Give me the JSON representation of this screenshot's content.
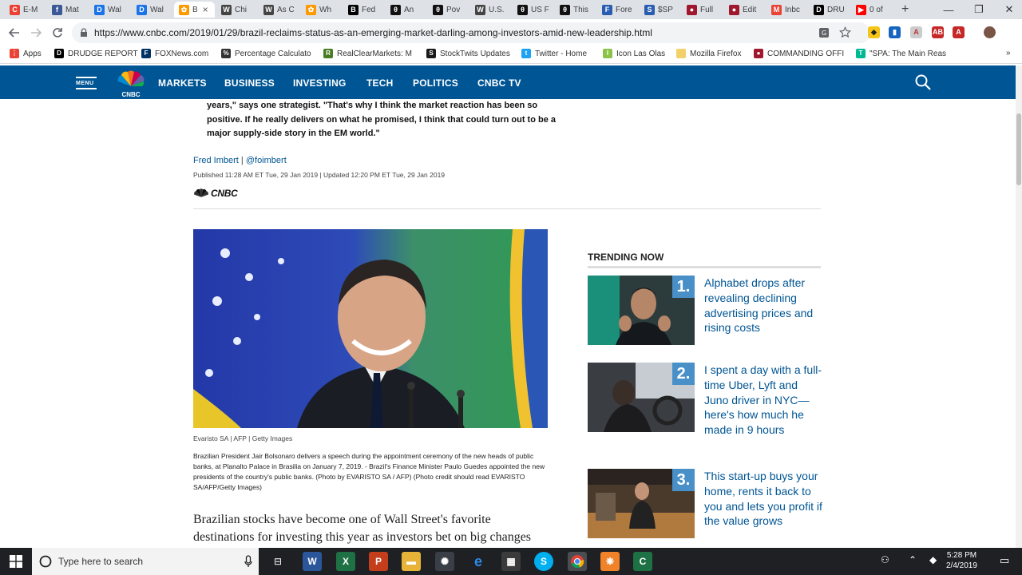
{
  "tabs": [
    {
      "label": "E-M",
      "icon": "gmail-icon",
      "color": "#ea4335",
      "glyph": "C"
    },
    {
      "label": "Mat",
      "icon": "facebook-icon",
      "color": "#3b5998",
      "glyph": "f"
    },
    {
      "label": "Wal",
      "icon": "wallet-icon",
      "color": "#1a73e8",
      "glyph": "D"
    },
    {
      "label": "Wal",
      "icon": "wallet-icon",
      "color": "#1a73e8",
      "glyph": "D"
    },
    {
      "label": "B",
      "icon": "cnbc-icon",
      "color": "#ff9900",
      "glyph": "✿",
      "active": true
    },
    {
      "label": "Chi",
      "icon": "wsj-icon",
      "color": "#444",
      "glyph": "W"
    },
    {
      "label": "As C",
      "icon": "wsj-icon",
      "color": "#444",
      "glyph": "W"
    },
    {
      "label": "Wh",
      "icon": "cnbc-icon",
      "color": "#ff9900",
      "glyph": "✿"
    },
    {
      "label": "Fed",
      "icon": "bloomberg-icon",
      "color": "#000",
      "glyph": "B"
    },
    {
      "label": "An",
      "icon": "barrons-icon",
      "color": "#111",
      "glyph": "θ"
    },
    {
      "label": "Pov",
      "icon": "barrons-icon",
      "color": "#111",
      "glyph": "θ"
    },
    {
      "label": "U.S.",
      "icon": "wsj-icon",
      "color": "#444",
      "glyph": "W"
    },
    {
      "label": "US F",
      "icon": "barrons-icon",
      "color": "#111",
      "glyph": "θ"
    },
    {
      "label": "This",
      "icon": "barrons-icon",
      "color": "#111",
      "glyph": "θ"
    },
    {
      "label": "Fore",
      "icon": "forex-icon",
      "color": "#2a5db0",
      "glyph": "F"
    },
    {
      "label": "$SP",
      "icon": "stockcharts-icon",
      "color": "#2a5db0",
      "glyph": "S"
    },
    {
      "label": "Full",
      "icon": "commanding-icon",
      "color": "#a0182e",
      "glyph": "●"
    },
    {
      "label": "Edit",
      "icon": "commanding-icon",
      "color": "#a0182e",
      "glyph": "●"
    },
    {
      "label": "Inbc",
      "icon": "gmail-icon",
      "color": "#ea4335",
      "glyph": "M"
    },
    {
      "label": "DRU",
      "icon": "drudge-icon",
      "color": "#000",
      "glyph": "D"
    },
    {
      "label": "0 of",
      "icon": "youtube-icon",
      "color": "#ff0000",
      "glyph": "▶"
    }
  ],
  "active_tab_close": "×",
  "new_tab": "+",
  "window_controls": {
    "minimize": "—",
    "restore": "❐",
    "close": "✕"
  },
  "address_bar": {
    "url": "https://www.cnbc.com/2019/01/29/brazil-reclaims-status-as-an-emerging-market-darling-among-investors-amid-new-leadership.html"
  },
  "bookmarks": [
    {
      "label": "Apps",
      "icon": "apps-grid-icon",
      "color": "#ea4335",
      "glyph": "⋮"
    },
    {
      "label": "DRUDGE REPORT",
      "icon": "drudge-icon",
      "color": "#000",
      "glyph": "D"
    },
    {
      "label": "FOXNews.com",
      "icon": "fox-icon",
      "color": "#003366",
      "glyph": "F"
    },
    {
      "label": "Percentage Calculato",
      "icon": "percent-icon",
      "color": "#333",
      "glyph": "%"
    },
    {
      "label": "RealClearMarkets: M",
      "icon": "rcm-icon",
      "color": "#4a7c23",
      "glyph": "R"
    },
    {
      "label": "StockTwits Updates",
      "icon": "stocktwits-icon",
      "color": "#1a1a1a",
      "glyph": "S"
    },
    {
      "label": "Twitter - Home",
      "icon": "twitter-icon",
      "color": "#1da1f2",
      "glyph": "t"
    },
    {
      "label": "Icon Las Olas",
      "icon": "icon-las-olas-icon",
      "color": "#8bc34a",
      "glyph": "I"
    },
    {
      "label": "Mozilla Firefox",
      "icon": "folder-icon",
      "color": "#f2d16b",
      "glyph": ""
    },
    {
      "label": "COMMANDING OFFI",
      "icon": "commanding-icon",
      "color": "#a0182e",
      "glyph": "●"
    },
    {
      "label": "\"SPA: The Main Reas",
      "icon": "spa-icon",
      "color": "#00b894",
      "glyph": "T"
    }
  ],
  "bookmarks_overflow": "»",
  "site_nav": {
    "menu": "MENU",
    "logo": "CNBC",
    "links": [
      "MARKETS",
      "BUSINESS",
      "INVESTING",
      "TECH",
      "POLITICS",
      "CNBC TV"
    ]
  },
  "article": {
    "quote": "years,\" says one strategist. \"That's why I think the market reaction has been so positive. If he really delivers on what he promised, I think that could turn out to be a major supply-side story in the EM world.\"",
    "author": "Fred Imbert",
    "author_sep": " | ",
    "author_handle": "@foimbert",
    "published": "Published 11:28 AM ET Tue, 29 Jan 2019 | Updated 12:20 PM ET Tue, 29 Jan 2019",
    "brand": "CNBC",
    "photo_credit": "Evaristo SA | AFP | Getty Images",
    "caption": "Brazilian President Jair Bolsonaro delivers a speech during the appointment ceremony of the new heads of public banks, at Planalto Palace in Brasilia on January 7, 2019. - Brazil's Finance Minister Paulo Guedes appointed the new presidents of the country's public banks. (Photo by EVARISTO SA / AFP) (Photo credit should read EVARISTO SA/AFP/Getty Images)",
    "body": "Brazilian stocks have become one of Wall Street's favorite destinations for investing this year as investors bet on big changes"
  },
  "trending": {
    "title": "TRENDING NOW",
    "items": [
      {
        "num": "1.",
        "title": "Alphabet drops after revealing declining advertising prices and rising costs"
      },
      {
        "num": "2.",
        "title": "I spent a day with a full-time Uber, Lyft and Juno driver in NYC—here's how much he made in 9 hours"
      },
      {
        "num": "3.",
        "title": "This start-up buys your home, rents it back to you and lets you profit if the value grows"
      }
    ]
  },
  "taskbar": {
    "search_placeholder": "Type here to search",
    "time": "5:28 PM",
    "date": "2/4/2019"
  },
  "colors": {
    "cnbc_blue": "#005594",
    "trend_badge": "#4a90c8",
    "taskbar": "#1f2023"
  }
}
